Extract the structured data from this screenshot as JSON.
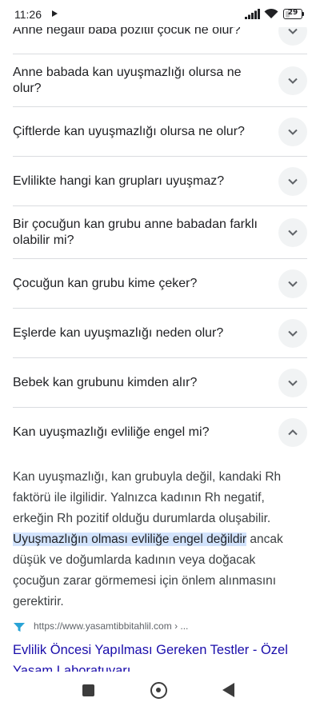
{
  "status": {
    "time": "11:26",
    "battery": "29",
    "battery_level": 0.29
  },
  "faq": [
    "Anne negatif baba pozitif çocuk ne olur?",
    "Anne babada kan uyuşmazlığı olursa ne olur?",
    "Çiftlerde kan uyuşmazlığı olursa ne olur?",
    "Evlilikte hangi kan grupları uyuşmaz?",
    "Bir çocuğun kan grubu anne babadan farklı olabilir mi?",
    "Çocuğun kan grubu kime çeker?",
    "Eşlerde kan uyuşmazlığı neden olur?",
    "Bebek kan grubunu kimden alır?",
    "Kan uyuşmazlığı evliliğe engel mi?"
  ],
  "answer": {
    "before": "Kan uyuşmazlığı, kan grubuyla değil, kandaki Rh faktörü ile ilgilidir. Yalnızca kadının Rh negatif, erkeğin Rh pozitif olduğu durumlarda oluşabilir. ",
    "highlight": "Uyuşmazlığın olması evliliğe engel değildir",
    "after": " ancak düşük ve doğumlarda kadının veya doğacak çocuğun zarar görmemesi için önlem alınmasını gerektirir."
  },
  "source": {
    "url": "https://www.yasamtibbitahlil.com › ...",
    "title": "Evlilik Öncesi Yapılması Gereken Testler - Özel Yaşam Laboratuvarı"
  }
}
